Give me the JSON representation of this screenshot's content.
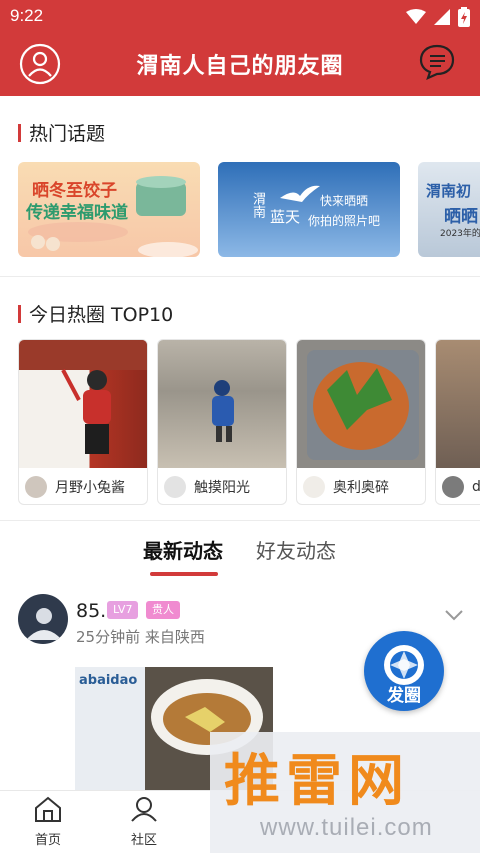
{
  "status_bar": {
    "time": "9:22"
  },
  "header": {
    "title": "渭南人自己的朋友圈"
  },
  "hot_topics": {
    "title": "热门话题",
    "cards": [
      {
        "line1": "晒冬至饺子",
        "line2": "传递幸福味道"
      },
      {
        "line1": "渭南",
        "line2": "蓝天",
        "line3": "快来晒晒",
        "line4": "你拍的照片吧"
      },
      {
        "line1": "渭南初",
        "line2": "晒晒",
        "line3": "2023年的"
      }
    ]
  },
  "top10": {
    "title": "今日热圈 TOP10",
    "cards": [
      {
        "name": "月野小兔酱"
      },
      {
        "name": "触摸阳光"
      },
      {
        "name": "奥利奥碎"
      },
      {
        "name": "d"
      }
    ]
  },
  "tabs": [
    {
      "label": "最新动态",
      "active": true
    },
    {
      "label": "好友动态",
      "active": false
    }
  ],
  "post": {
    "username": "85.",
    "level_badge": "LV7",
    "title_badge": "贵人",
    "meta": "25分钟前  来自陕西",
    "image_text": "abaidao"
  },
  "fab": {
    "label": "发圈"
  },
  "bottom_nav": [
    {
      "label": "首页",
      "icon": "home-icon"
    },
    {
      "label": "社区",
      "icon": "community-icon"
    }
  ],
  "watermark": {
    "text": "推雷网",
    "url": "www.tuilei.com"
  },
  "colors": {
    "brand": "#d23a3a",
    "fab": "#1f6fd0",
    "badge_level": "#e7a0e0",
    "badge_title": "#f08bd0"
  }
}
